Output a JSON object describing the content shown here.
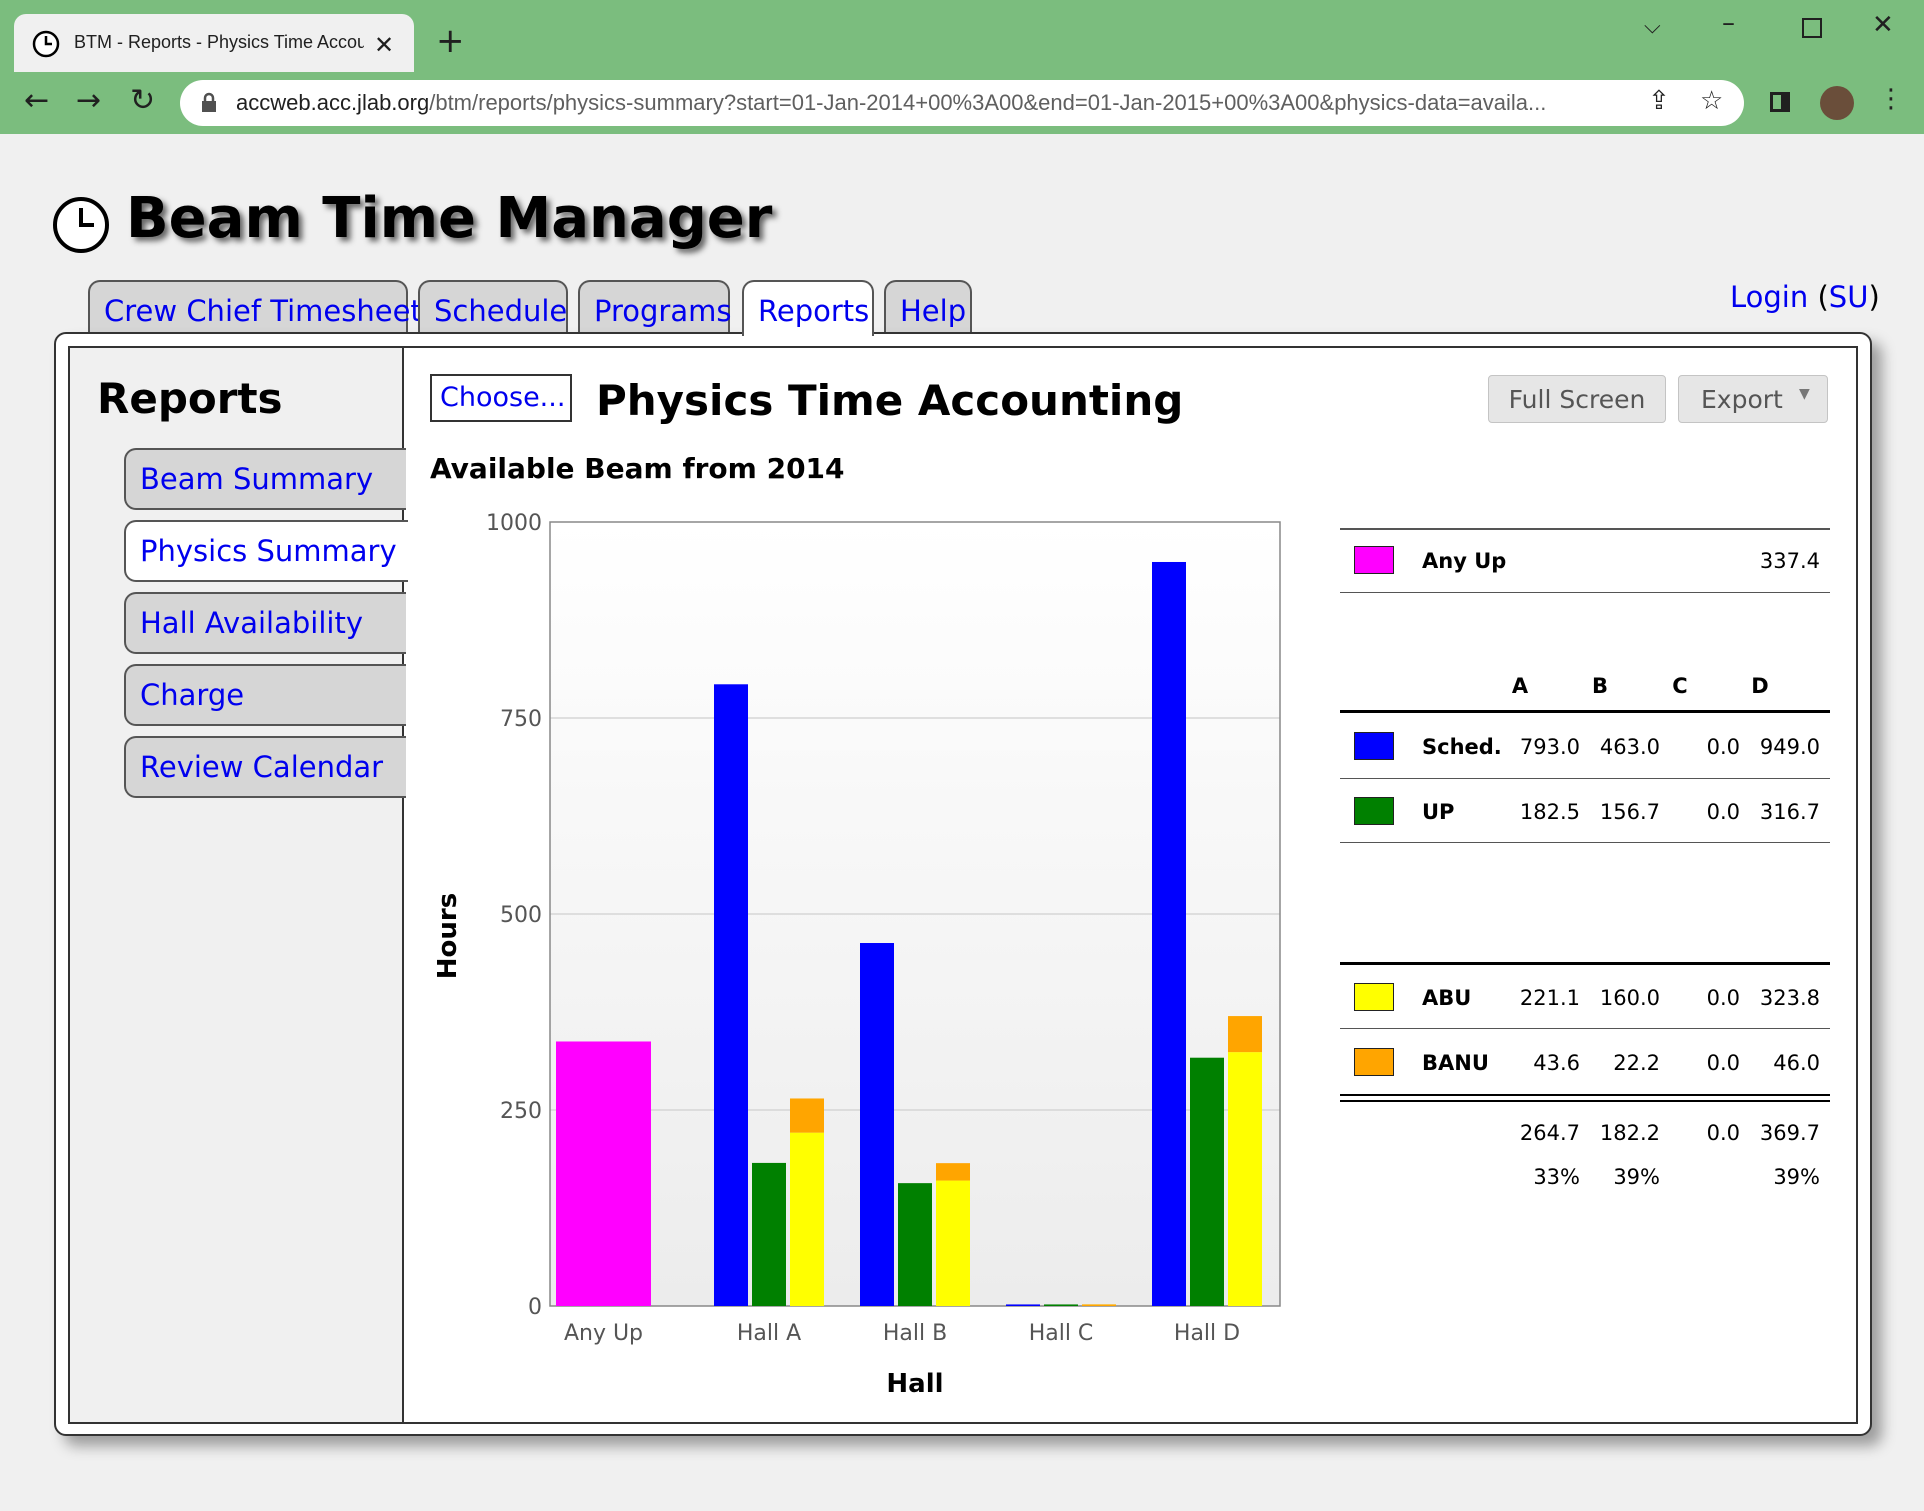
{
  "browser": {
    "tab_title": "BTM - Reports - Physics Time Accou",
    "url_host": "accweb.acc.jlab.org",
    "url_path": "/btm/reports/physics-summary?start=01-Jan-2014+00%3A00&end=01-Jan-2015+00%3A00&physics-data=availa..."
  },
  "page": {
    "title": "Beam Time Manager",
    "login_label": "Login",
    "su_label": "SU"
  },
  "nav": {
    "tabs": [
      {
        "label": "Crew Chief Timesheet"
      },
      {
        "label": "Schedule"
      },
      {
        "label": "Programs"
      },
      {
        "label": "Reports",
        "active": true
      },
      {
        "label": "Help"
      }
    ]
  },
  "sidebar": {
    "title": "Reports",
    "items": [
      {
        "label": "Beam Summary"
      },
      {
        "label": "Physics Summary",
        "active": true
      },
      {
        "label": "Hall Availability"
      },
      {
        "label": "Charge"
      },
      {
        "label": "Review Calendar"
      }
    ]
  },
  "main": {
    "choose_label": "Choose...",
    "report_title": "Physics Time Accounting",
    "full_screen_label": "Full Screen",
    "export_label": "Export",
    "chart_heading": "Available Beam from 2014"
  },
  "colors": {
    "any_up": "#ff00ff",
    "sched": "#0000ff",
    "up": "#008000",
    "abu": "#ffff00",
    "banu": "#ffa500"
  },
  "chart_data": {
    "type": "bar",
    "categories": [
      "Any Up",
      "Hall A",
      "Hall B",
      "Hall C",
      "Hall D"
    ],
    "xlabel": "Hall",
    "ylabel": "Hours",
    "ylim": [
      0,
      1000
    ],
    "yticks": [
      0,
      250,
      500,
      750,
      1000
    ],
    "grid": true,
    "legend": "right",
    "any_up": 337.4,
    "series": [
      {
        "name": "Sched.",
        "values": [
          793.0,
          463.0,
          0.0,
          949.0
        ]
      },
      {
        "name": "UP",
        "values": [
          182.5,
          156.7,
          0.0,
          316.7
        ]
      },
      {
        "name": "ABU",
        "values": [
          221.1,
          160.0,
          0.0,
          323.8
        ]
      },
      {
        "name": "BANU",
        "values": [
          43.6,
          22.2,
          0.0,
          46.0
        ]
      }
    ]
  },
  "legend_table": {
    "any_up_label": "Any Up",
    "any_up_value": "337.4",
    "columns": [
      "A",
      "B",
      "C",
      "D"
    ],
    "rows1": [
      {
        "label": "Sched.",
        "values": [
          "793.0",
          "463.0",
          "0.0",
          "949.0"
        ]
      },
      {
        "label": "UP",
        "values": [
          "182.5",
          "156.7",
          "0.0",
          "316.7"
        ]
      }
    ],
    "rows2": [
      {
        "label": "ABU",
        "values": [
          "221.1",
          "160.0",
          "0.0",
          "323.8"
        ]
      },
      {
        "label": "BANU",
        "values": [
          "43.6",
          "22.2",
          "0.0",
          "46.0"
        ]
      }
    ],
    "totals": [
      "264.7",
      "182.2",
      "0.0",
      "369.7"
    ],
    "percents": [
      "33%",
      "39%",
      "",
      "39%"
    ]
  }
}
